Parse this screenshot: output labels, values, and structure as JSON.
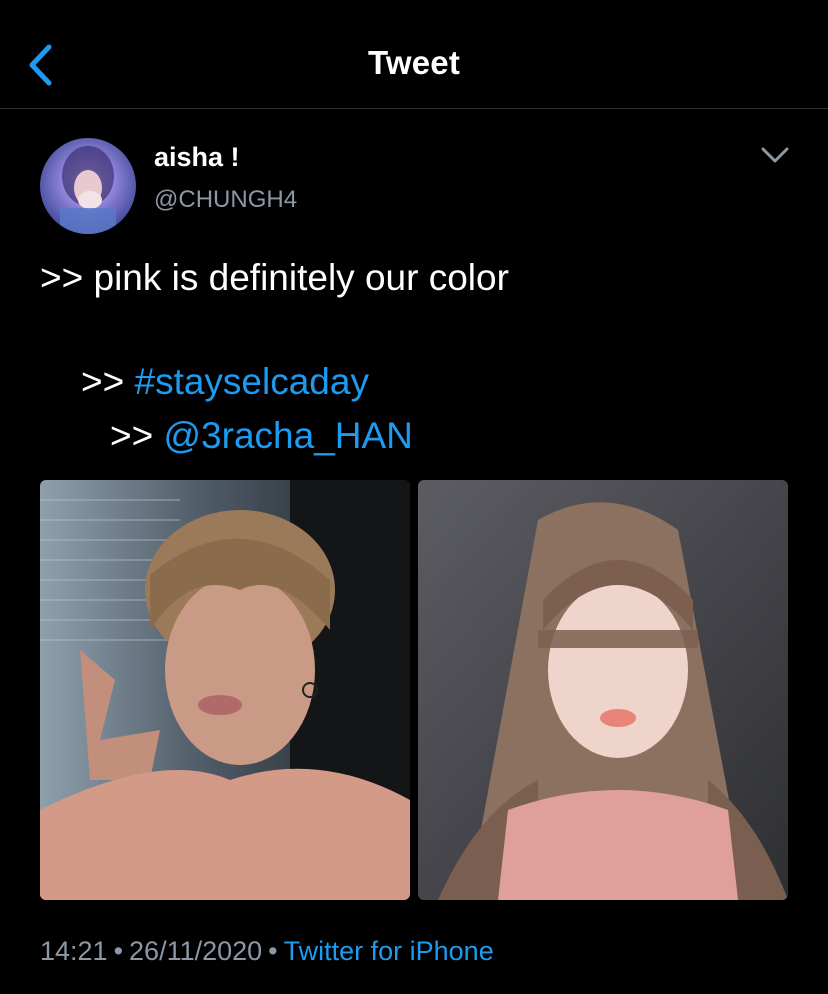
{
  "header": {
    "title": "Tweet",
    "back_icon": "chevron-left-icon"
  },
  "tweet": {
    "display_name": "aisha !",
    "handle": "@CHUNGH4",
    "menu_icon": "chevron-down-icon",
    "line1": ">> pink is definitely our color",
    "line2_prefix": ">> ",
    "hashtag": "#stayselcaday",
    "line3_prefix": ">> ",
    "mention": "@3racha_HAN",
    "time": "14:21",
    "separator": "•",
    "date": "26/11/2020",
    "source": "Twitter for iPhone"
  },
  "colors": {
    "background": "#000000",
    "link": "#1d9bf0",
    "secondary_text": "#8b98a5",
    "divider": "#2f3336"
  }
}
